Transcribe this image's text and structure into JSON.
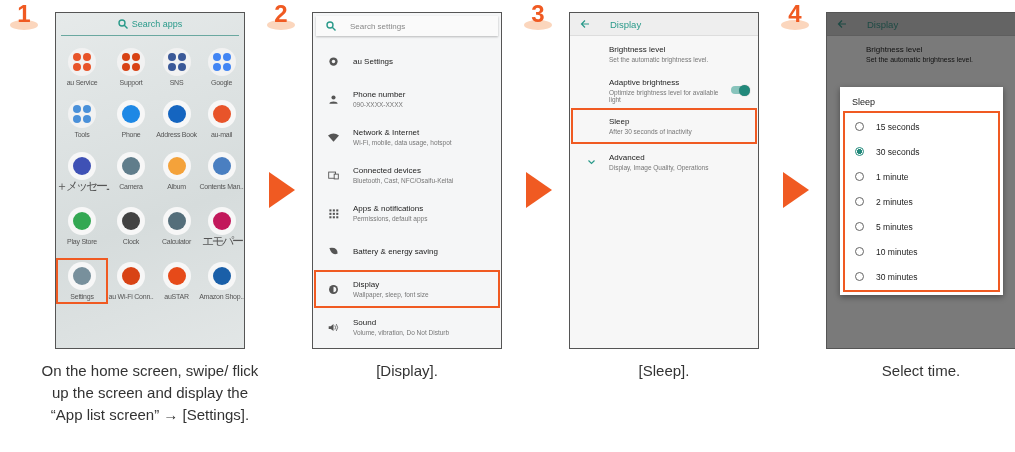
{
  "steps": [
    {
      "number": "1",
      "caption": "On the home screen, swipe/ flick up the screen and display the “App list screen” → [Settings].",
      "screen": {
        "kind": "app_list",
        "search_placeholder": "Search apps",
        "apps": [
          {
            "label": "au Service",
            "kind": "folder",
            "color": "#e8542a",
            "highlighted": false
          },
          {
            "label": "Support",
            "kind": "folder",
            "color": "#d84315",
            "highlighted": false
          },
          {
            "label": "SNS",
            "kind": "folder",
            "color": "#3b5998",
            "highlighted": false
          },
          {
            "label": "Google",
            "kind": "folder",
            "color": "#4285f4",
            "highlighted": false
          },
          {
            "label": "Tools",
            "kind": "folder",
            "color": "#4a90d9",
            "highlighted": false
          },
          {
            "label": "Phone",
            "kind": "app",
            "color": "#1e88e5",
            "highlighted": false
          },
          {
            "label": "Address Book",
            "kind": "app",
            "color": "#1565c0",
            "highlighted": false
          },
          {
            "label": "au-mail",
            "kind": "app",
            "color": "#e8542a",
            "highlighted": false
          },
          {
            "label": "＋メッセー..",
            "kind": "app",
            "color": "#3f51b5",
            "highlighted": false
          },
          {
            "label": "Camera",
            "kind": "app",
            "color": "#607d8b",
            "highlighted": false
          },
          {
            "label": "Album",
            "kind": "app",
            "color": "#f4a23a",
            "highlighted": false
          },
          {
            "label": "Contents Man..",
            "kind": "app",
            "color": "#4a7fc1",
            "highlighted": false
          },
          {
            "label": "Play Store",
            "kind": "app",
            "color": "#34a853",
            "highlighted": false
          },
          {
            "label": "Clock",
            "kind": "app",
            "color": "#424242",
            "highlighted": false
          },
          {
            "label": "Calculator",
            "kind": "app",
            "color": "#546e7a",
            "highlighted": false
          },
          {
            "label": "エモパー",
            "kind": "app",
            "color": "#c2185b",
            "highlighted": false
          },
          {
            "label": "Settings",
            "kind": "app",
            "color": "#78909c",
            "highlighted": true
          },
          {
            "label": "au Wi-Fi Conn..",
            "kind": "app",
            "color": "#d84315",
            "highlighted": false
          },
          {
            "label": "auSTAR",
            "kind": "app",
            "color": "#e64a19",
            "highlighted": false
          },
          {
            "label": "Amazon Shop..",
            "kind": "app",
            "color": "#1a5fa8",
            "highlighted": false
          }
        ]
      }
    },
    {
      "number": "2",
      "caption": "[Display].",
      "screen": {
        "kind": "settings",
        "search_placeholder": "Search settings",
        "items": [
          {
            "title": "au Settings",
            "highlighted": false
          },
          {
            "title": "Phone number",
            "subtitle": "090-XXXX-XXXX",
            "highlighted": false
          },
          {
            "title": "Network & Internet",
            "subtitle": "Wi-Fi, mobile, data usage, hotspot",
            "highlighted": false
          },
          {
            "title": "Connected devices",
            "subtitle": "Bluetooth, Cast, NFC/Osaifu-Keitai",
            "highlighted": false
          },
          {
            "title": "Apps & notifications",
            "subtitle": "Permissions, default apps",
            "highlighted": false
          },
          {
            "title": "Battery & energy saving",
            "highlighted": false
          },
          {
            "title": "Display",
            "subtitle": "Wallpaper, sleep, font size",
            "highlighted": true
          },
          {
            "title": "Sound",
            "subtitle": "Volume, vibration, Do Not Disturb",
            "highlighted": false
          }
        ]
      }
    },
    {
      "number": "3",
      "caption": "[Sleep].",
      "screen": {
        "kind": "display",
        "title": "Display",
        "items": [
          {
            "kind": "plain",
            "title": "Brightness level",
            "subtitle": "Set the automatic brightness level.",
            "highlighted": false
          },
          {
            "kind": "toggle",
            "title": "Adaptive brightness",
            "subtitle": "Optimize brightness level for available light",
            "on": true,
            "highlighted": false
          },
          {
            "kind": "plain",
            "title": "Sleep",
            "subtitle": "After 30 seconds of inactivity",
            "highlighted": true
          },
          {
            "kind": "expander",
            "title": "Advanced",
            "subtitle": "Display, Image Quality, Operations",
            "highlighted": false
          }
        ]
      }
    },
    {
      "number": "4",
      "caption": "Select time.",
      "screen": {
        "kind": "dialog",
        "title": "Display",
        "background_item": {
          "title": "Brightness level",
          "subtitle": "Set the automatic brightness level."
        },
        "dialog": {
          "title": "Sleep",
          "highlighted": true,
          "options": [
            {
              "label": "15 seconds",
              "selected": false
            },
            {
              "label": "30 seconds",
              "selected": true
            },
            {
              "label": "1 minute",
              "selected": false
            },
            {
              "label": "2 minutes",
              "selected": false
            },
            {
              "label": "5 minutes",
              "selected": false
            },
            {
              "label": "10 minutes",
              "selected": false
            },
            {
              "label": "30 minutes",
              "selected": false
            }
          ]
        }
      }
    }
  ]
}
